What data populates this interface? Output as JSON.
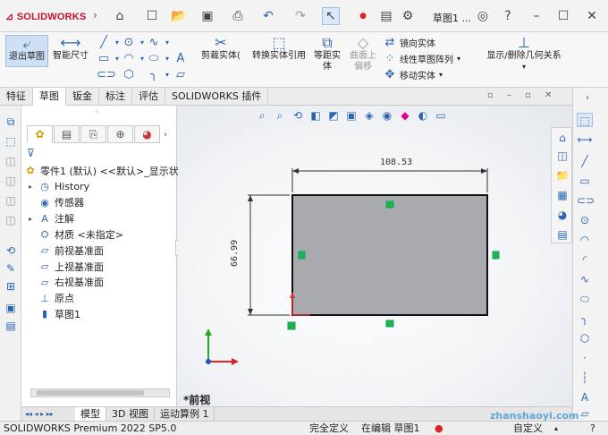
{
  "app": {
    "logo": "SOLIDWORKS",
    "doc_title": "草图1 ..."
  },
  "colors": {
    "accent": "#2b66b1",
    "brand": "#c8102e",
    "handle_green": "#22b14c",
    "rect_fill": "#a9aaae"
  },
  "titlebar": {
    "icons": [
      "home-icon",
      "new-icon",
      "open-icon",
      "save-icon",
      "print-icon",
      "undo-icon",
      "redo-icon",
      "select-icon",
      "traffic-light-icon",
      "properties-icon",
      "options-icon"
    ],
    "search": "草图1 ...",
    "help_icon": "help-icon"
  },
  "ribbon": {
    "exit_sketch": "退出草图",
    "smart_dimension": "智能尺寸",
    "trim": "剪裁实体(",
    "convert": "转换实体引用",
    "offset": "等距实\n体",
    "surface_offset": "曲面上\n偏移",
    "mirror": "镜向实体",
    "linear_pattern": "线性草图阵列",
    "move": "移动实体",
    "relations": "显示/删除几何关系"
  },
  "tabs": [
    "特征",
    "草图",
    "钣金",
    "标注",
    "评估",
    "SOLIDWORKS 插件"
  ],
  "active_tab": "草图",
  "tree": {
    "root": "零件1 (默认) <<默认>_显示状",
    "items": [
      {
        "label": "History",
        "icon": "history-icon",
        "expandable": true
      },
      {
        "label": "传感器",
        "icon": "sensor-icon",
        "expandable": false
      },
      {
        "label": "注解",
        "icon": "annotation-icon",
        "expandable": true
      },
      {
        "label": "材质 <未指定>",
        "icon": "material-icon",
        "expandable": false
      },
      {
        "label": "前视基准面",
        "icon": "plane-icon",
        "expandable": false
      },
      {
        "label": "上视基准面",
        "icon": "plane-icon",
        "expandable": false
      },
      {
        "label": "右视基准面",
        "icon": "plane-icon",
        "expandable": false
      },
      {
        "label": "原点",
        "icon": "origin-icon",
        "expandable": false
      },
      {
        "label": "草图1",
        "icon": "sketch-icon",
        "expandable": false
      }
    ]
  },
  "drawing": {
    "width_dim": "108.53",
    "height_dim": "66.99",
    "view_label": "*前视"
  },
  "bottom_tabs": [
    "模型",
    "3D 视图",
    "运动算例 1"
  ],
  "active_bottom_tab": "模型",
  "status": {
    "product": "SOLIDWORKS Premium 2022 SP5.0",
    "definition": "完全定义",
    "editing": "在编辑 草图1",
    "custom": "自定义",
    "watermark": "zhanshaoyi.com"
  }
}
